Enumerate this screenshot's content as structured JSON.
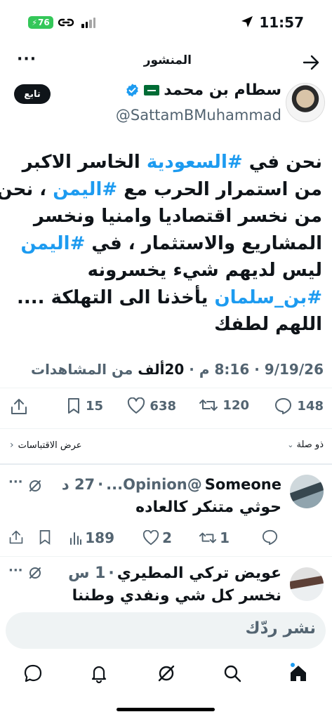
{
  "status_bar": {
    "time": "11:57",
    "battery": "76"
  },
  "header": {
    "title": "المنشور"
  },
  "author": {
    "name": "سطام بن محمد",
    "handle": "@SattamBMuhammad",
    "follow_label": "تابع"
  },
  "tweet": {
    "lines": [
      [
        {
          "t": "نحن في ",
          "tag": false
        },
        {
          "t": "#السعودية",
          "tag": true
        },
        {
          "t": " الخاسر الاكبر",
          "tag": false
        }
      ],
      [
        {
          "t": "من استمرار الحرب مع ",
          "tag": false
        },
        {
          "t": "#اليمن",
          "tag": true
        },
        {
          "t": " ، نحن",
          "tag": false
        }
      ],
      [
        {
          "t": "من نخسر اقتصاديا وامنيا ونخسر",
          "tag": false
        }
      ],
      [
        {
          "t": "المشاريع والاستثمار ، في ",
          "tag": false
        },
        {
          "t": "#اليمن",
          "tag": true
        }
      ],
      [
        {
          "t": "ليس لديهم شيء يخسرونه",
          "tag": false
        }
      ],
      [
        {
          "t": "#بن_سلمان",
          "tag": true
        },
        {
          "t": " يأخذنا الى التهلكة ....",
          "tag": false
        }
      ],
      [
        {
          "t": "اللهم لطفك",
          "tag": false
        }
      ]
    ],
    "date": "9/19/26",
    "time": "8:16 م",
    "views_count": "20ألف",
    "views_label": "من المشاهدات",
    "separator": "·"
  },
  "actions": {
    "replies": "148",
    "reposts": "120",
    "likes": "638",
    "bookmarks": "15"
  },
  "sort_bar": {
    "sort_label": "ذو صلة",
    "quotes_label": "عرض الاقتباسات"
  },
  "replies": [
    {
      "name": "Someone",
      "handle": "@Opinion...",
      "ellipsis": "...",
      "age": "27 د",
      "text": "حوثي متنكر كالعاده",
      "replies": "",
      "reposts": "1",
      "likes": "2",
      "views": "189"
    },
    {
      "name": "عويض تركي المطيري",
      "age": "1 س",
      "text": "نخسر كل شي ونفدي وطننا"
    }
  ],
  "composer": {
    "placeholder": "نشر ردّك"
  },
  "colors": {
    "accent": "#1d9bf0",
    "text": "#0f1419",
    "muted": "#536471"
  }
}
